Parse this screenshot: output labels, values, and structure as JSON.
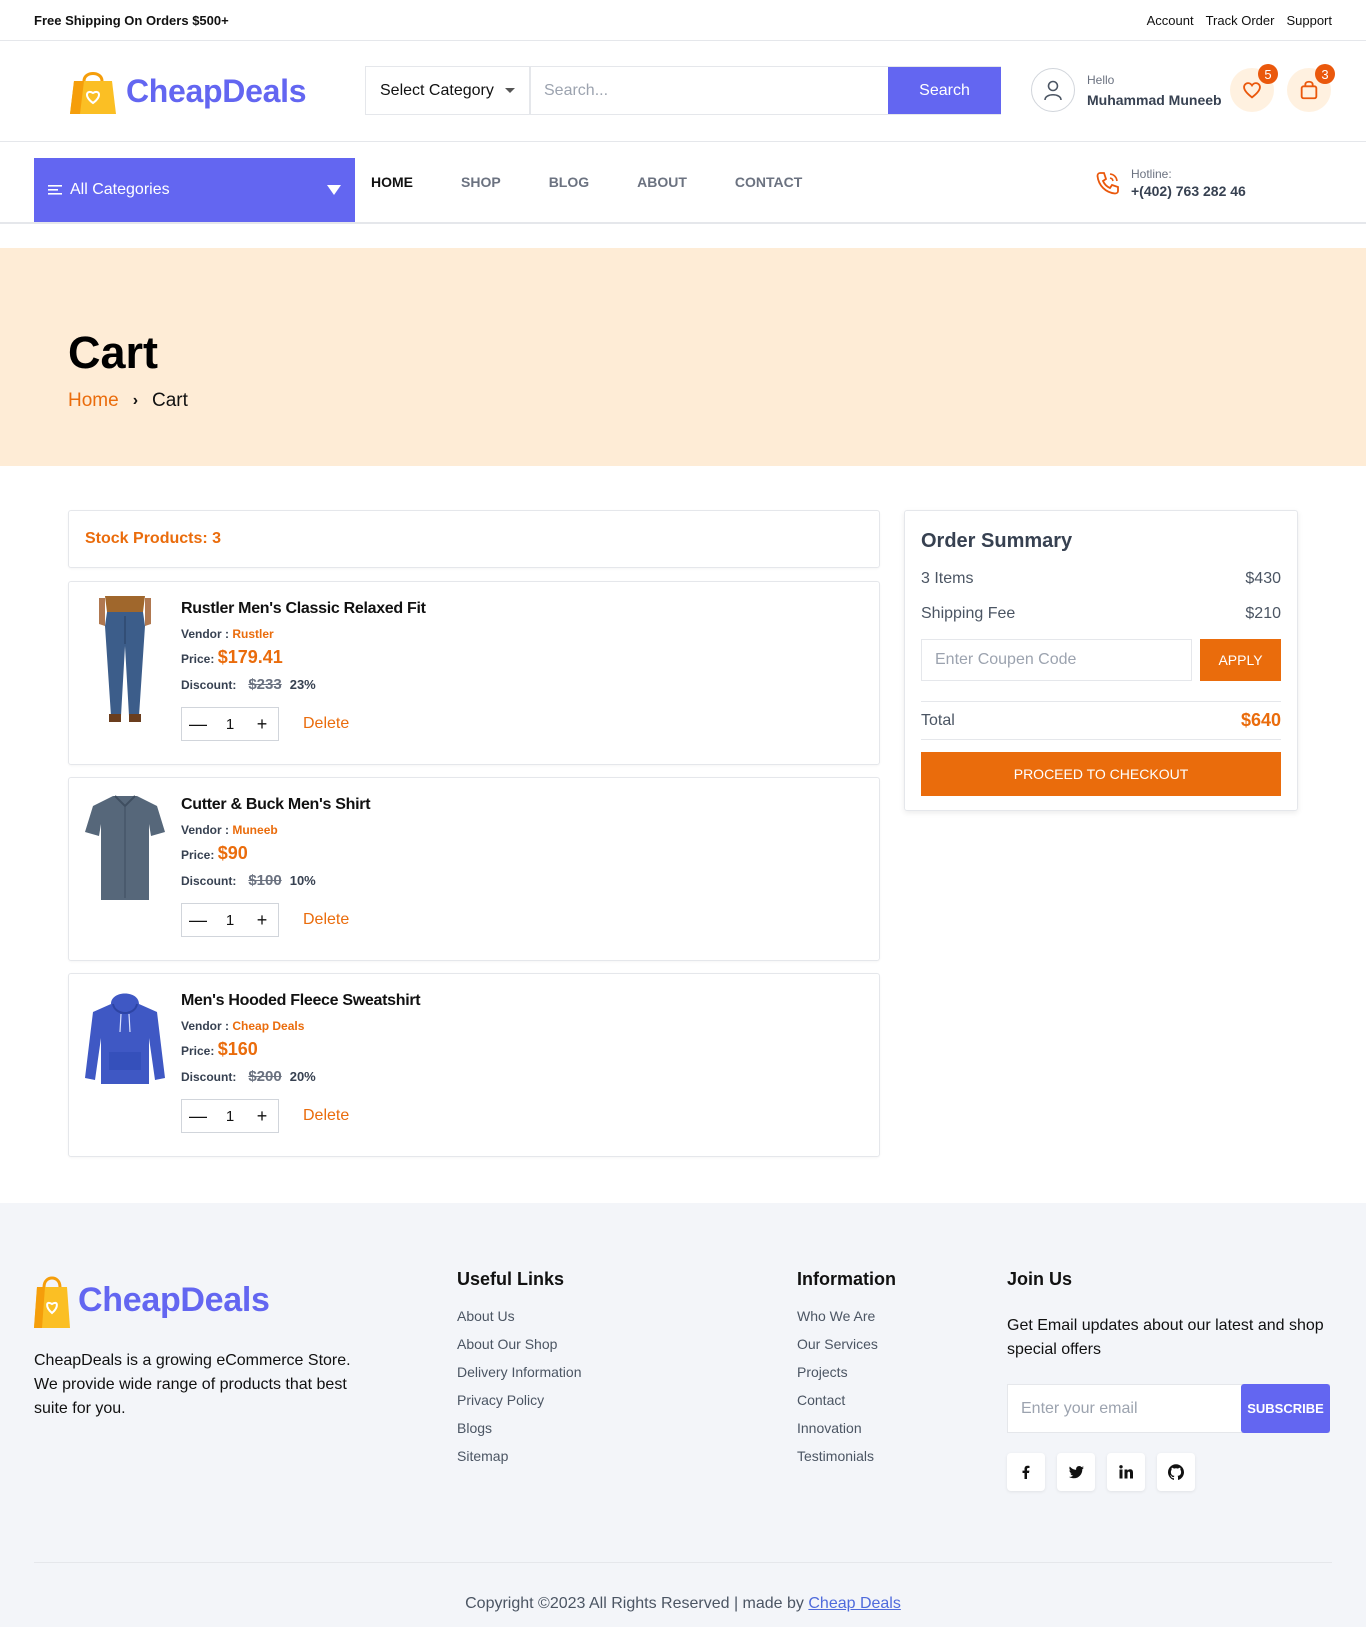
{
  "topbar": {
    "shipping_text": "Free Shipping On Orders $500+",
    "links": [
      "Account",
      "Track Order",
      "Support"
    ]
  },
  "header": {
    "logo_text": "CheapDeals",
    "category_select": "Select Category",
    "search_placeholder": "Search...",
    "search_button": "Search",
    "greeting": "Hello",
    "user_name": "Muhammad Muneeb",
    "wishlist_count": "5",
    "cart_count": "3"
  },
  "nav": {
    "all_categories": "All Categories",
    "menu": [
      "HOME",
      "SHOP",
      "BLOG",
      "ABOUT",
      "CONTACT"
    ],
    "hotline_label": "Hotline:",
    "hotline_number": "+(402) 763 282 46"
  },
  "banner": {
    "title": "Cart",
    "crumb_home": "Home",
    "crumb_current": "Cart"
  },
  "cart": {
    "stock_label": "Stock Products: 3",
    "vendor_label": "Vendor :",
    "price_label": "Price:",
    "discount_label": "Discount:",
    "delete_label": "Delete",
    "items": [
      {
        "name": "Rustler Men's Classic Relaxed Fit",
        "vendor": "Rustler",
        "price": "$179.41",
        "old_price": "$233",
        "discount": "23%",
        "qty": "1"
      },
      {
        "name": "Cutter & Buck Men's Shirt",
        "vendor": "Muneeb",
        "price": "$90",
        "old_price": "$100",
        "discount": "10%",
        "qty": "1"
      },
      {
        "name": "Men's Hooded Fleece Sweatshirt",
        "vendor": "Cheap Deals",
        "price": "$160",
        "old_price": "$200",
        "discount": "20%",
        "qty": "1"
      }
    ]
  },
  "summary": {
    "title": "Order Summary",
    "items_label": "3 Items",
    "items_value": "$430",
    "shipping_label": "Shipping Fee",
    "shipping_value": "$210",
    "coupon_placeholder": "Enter Coupen Code",
    "apply_button": "APPLY",
    "total_label": "Total",
    "total_value": "$640",
    "checkout_button": "PROCEED TO CHECKOUT"
  },
  "footer": {
    "logo_text": "CheapDeals",
    "description": "CheapDeals is a growing eCommerce Store. We provide wide range of products that best suite for you.",
    "useful_title": "Useful Links",
    "useful_links": [
      "About Us",
      "About Our Shop",
      "Delivery Information",
      "Privacy Policy",
      "Blogs",
      "Sitemap"
    ],
    "info_title": "Information",
    "info_links": [
      "Who We Are",
      "Our Services",
      "Projects",
      "Contact",
      "Innovation",
      "Testimonials"
    ],
    "join_title": "Join Us",
    "join_text": "Get Email updates about our latest and shop special offers",
    "email_placeholder": "Enter your email",
    "subscribe_button": "SUBSCRIBE",
    "social_icons": [
      "facebook-icon",
      "twitter-icon",
      "linkedin-icon",
      "github-icon"
    ],
    "copyright": "Copyright ©2023 All Rights Reserved | made by",
    "copyright_link": "Cheap Deals"
  },
  "colors": {
    "brand": "#6366f1",
    "accent": "#ea6c0c",
    "banner_bg": "#feecd6",
    "footer_bg": "#f3f5f9"
  }
}
